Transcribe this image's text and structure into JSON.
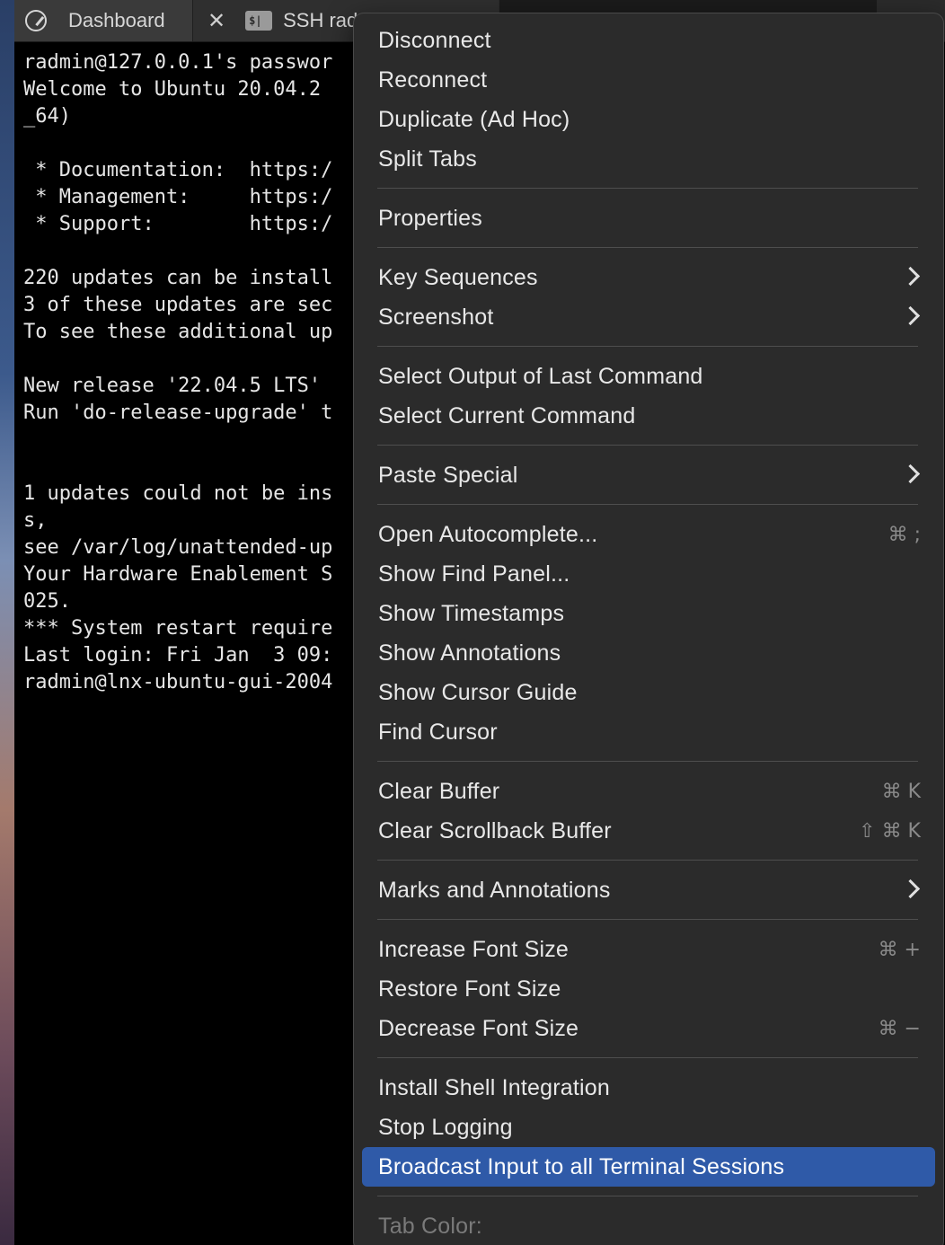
{
  "tabs": {
    "dashboard_label": "Dashboard",
    "close_glyph": "✕",
    "terminal_icon_text": "$|",
    "ssh_label": "SSH rad"
  },
  "terminal": {
    "lines": [
      "radmin@127.0.0.1's passwor",
      "Welcome to Ubuntu 20.04.2 ",
      "_64)",
      "",
      " * Documentation:  https:/",
      " * Management:     https:/",
      " * Support:        https:/",
      "",
      "220 updates can be install",
      "3 of these updates are sec",
      "To see these additional up",
      "",
      "New release '22.04.5 LTS' ",
      "Run 'do-release-upgrade' t",
      "",
      "",
      "1 updates could not be ins",
      "s,",
      "see /var/log/unattended-up",
      "Your Hardware Enablement S",
      "025.",
      "*** System restart require",
      "Last login: Fri Jan  3 09:",
      "radmin@lnx-ubuntu-gui-2004"
    ]
  },
  "menu": {
    "items": [
      {
        "label": "Disconnect"
      },
      {
        "label": "Reconnect"
      },
      {
        "label": "Duplicate (Ad Hoc)"
      },
      {
        "label": "Split Tabs"
      },
      {
        "label": "Properties"
      },
      {
        "label": "Key Sequences"
      },
      {
        "label": "Screenshot"
      },
      {
        "label": "Select Output of Last Command"
      },
      {
        "label": "Select Current Command"
      },
      {
        "label": "Paste Special"
      },
      {
        "label": "Open Autocomplete...",
        "shortcut": "⌘ ;"
      },
      {
        "label": "Show Find Panel..."
      },
      {
        "label": "Show Timestamps"
      },
      {
        "label": "Show Annotations"
      },
      {
        "label": "Show Cursor Guide"
      },
      {
        "label": "Find Cursor"
      },
      {
        "label": "Clear Buffer",
        "shortcut": "⌘ K"
      },
      {
        "label": "Clear Scrollback Buffer",
        "shortcut": "⇧ ⌘ K"
      },
      {
        "label": "Marks and Annotations"
      },
      {
        "label": "Increase Font Size",
        "shortcut": "⌘ +"
      },
      {
        "label": "Restore Font Size"
      },
      {
        "label": "Decrease Font Size",
        "shortcut": "⌘ −"
      },
      {
        "label": "Install Shell Integration"
      },
      {
        "label": "Stop Logging"
      },
      {
        "label": "Broadcast Input to all Terminal Sessions"
      },
      {
        "label": "Tab Color:"
      }
    ]
  },
  "colors": {
    "menu_background": "#2b2b2b",
    "highlight": "#2f5aa8",
    "terminal_background": "#000000",
    "terminal_text": "#e6e6e6"
  }
}
